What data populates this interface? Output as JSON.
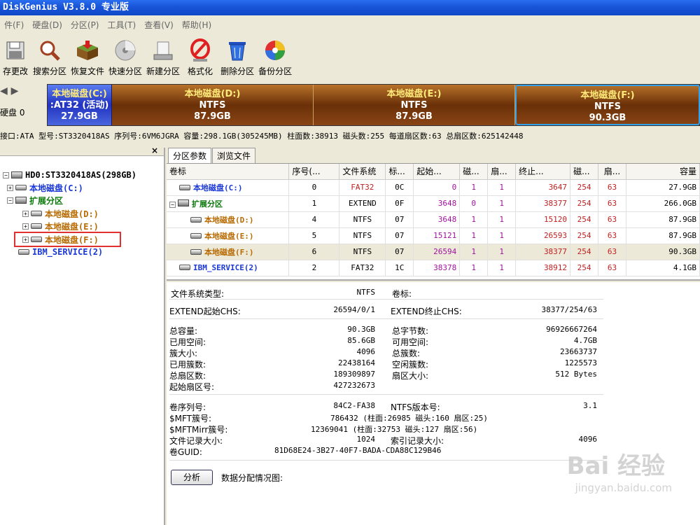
{
  "title": "DiskGenius V3.8.0 专业版",
  "menu": [
    "件(F)",
    "硬盘(D)",
    "分区(P)",
    "工具(T)",
    "查看(V)",
    "帮助(H)"
  ],
  "toolbar": {
    "save": "存更改",
    "search": "搜索分区",
    "recover": "恢复文件",
    "quick": "快速分区",
    "new": "新建分区",
    "format": "格式化",
    "delete": "删除分区",
    "backup": "备份分区"
  },
  "diskmap": {
    "disk_label": "硬盘 0",
    "segments": [
      {
        "name": "本地磁盘(C:)",
        "fs": ":AT32 (活动)",
        "size": "27.9GB"
      },
      {
        "name": "本地磁盘(D:)",
        "fs": "NTFS",
        "size": "87.9GB"
      },
      {
        "name": "本地磁盘(E:)",
        "fs": "NTFS",
        "size": "87.9GB"
      },
      {
        "name": "本地磁盘(F:)",
        "fs": "NTFS",
        "size": "90.3GB"
      }
    ]
  },
  "infoline": "接口:ATA  型号:ST3320418AS  序列号:6VM6JGRA  容量:298.1GB(305245MB)  柱面数:38913  磁头数:255  每道扇区数:63  总扇区数:625142448",
  "tree": {
    "root": "HD0:ST3320418AS(298GB)",
    "c": "本地磁盘(C:)",
    "ext": "扩展分区",
    "d": "本地磁盘(D:)",
    "e": "本地磁盘(E:)",
    "f": "本地磁盘(F:)",
    "ibm": "IBM_SERVICE(2)"
  },
  "tabs": [
    "分区参数",
    "浏览文件"
  ],
  "table": {
    "headers": [
      "卷标",
      "序号(...",
      "文件系统",
      "标...",
      "起始...",
      "磁...",
      "扇...",
      "终止...",
      "磁...",
      "扇...",
      "容量"
    ],
    "rows": [
      [
        "本地磁盘(C:)",
        "0",
        "FAT32",
        "0C",
        "0",
        "1",
        "1",
        "3647",
        "254",
        "63",
        "27.9GB"
      ],
      [
        "扩展分区",
        "1",
        "EXTEND",
        "0F",
        "3648",
        "0",
        "1",
        "38377",
        "254",
        "63",
        "266.0GB"
      ],
      [
        "本地磁盘(D:)",
        "4",
        "NTFS",
        "07",
        "3648",
        "1",
        "1",
        "15120",
        "254",
        "63",
        "87.9GB"
      ],
      [
        "本地磁盘(E:)",
        "5",
        "NTFS",
        "07",
        "15121",
        "1",
        "1",
        "26593",
        "254",
        "63",
        "87.9GB"
      ],
      [
        "本地磁盘(F:)",
        "6",
        "NTFS",
        "07",
        "26594",
        "1",
        "1",
        "38377",
        "254",
        "63",
        "90.3GB"
      ],
      [
        "IBM_SERVICE(2)",
        "2",
        "FAT32",
        "1C",
        "38378",
        "1",
        "1",
        "38912",
        "254",
        "63",
        "4.1GB"
      ]
    ]
  },
  "details": {
    "fs_type_l": "文件系统类型:",
    "fs_type_v": "NTFS",
    "vol_l": "卷标:",
    "ext_start_l": "EXTEND起始CHS:",
    "ext_start_v": "26594/0/1",
    "ext_end_l": "EXTEND终止CHS:",
    "ext_end_v": "38377/254/63",
    "total_l": "总容量:",
    "total_v": "90.3GB",
    "used_l": "已用空间:",
    "used_v": "85.6GB",
    "cluster_l": "簇大小:",
    "cluster_v": "4096",
    "usedc_l": "已用簇数:",
    "usedc_v": "22438164",
    "totsec_l": "总扇区数:",
    "totsec_v": "189309897",
    "startsec_l": "起始扇区号:",
    "startsec_v": "427232673",
    "totbytes_l": "总字节数:",
    "totbytes_v": "96926667264",
    "free_l": "可用空间:",
    "free_v": "4.7GB",
    "totc_l": "总簇数:",
    "totc_v": "23663737",
    "freec_l": "空闲簇数:",
    "freec_v": "1225573",
    "secsize_l": "扇区大小:",
    "secsize_v": "512 Bytes",
    "serial_l": "卷序列号:",
    "serial_v": "84C2-FA38",
    "ntfsver_l": "NTFS版本号:",
    "ntfsver_v": "3.1",
    "mft_l": "$MFT簇号:",
    "mft_v": "786432 (柱面:26985 磁头:160 扇区:25)",
    "mftm_l": "$MFTMirr簇号:",
    "mftm_v": "12369041 (柱面:32753 磁头:127 扇区:56)",
    "rec_l": "文件记录大小:",
    "rec_v": "1024",
    "idx_l": "索引记录大小:",
    "idx_v": "4096",
    "guid_l": "卷GUID:",
    "guid_v": "81D68E24-3B27-40F7-BADA-CDA88C129B46",
    "analyze": "分析",
    "alloc": "数据分配情况图:"
  },
  "watermark": {
    "brand": "Bai 经验",
    "url": "jingyan.baidu.com"
  }
}
